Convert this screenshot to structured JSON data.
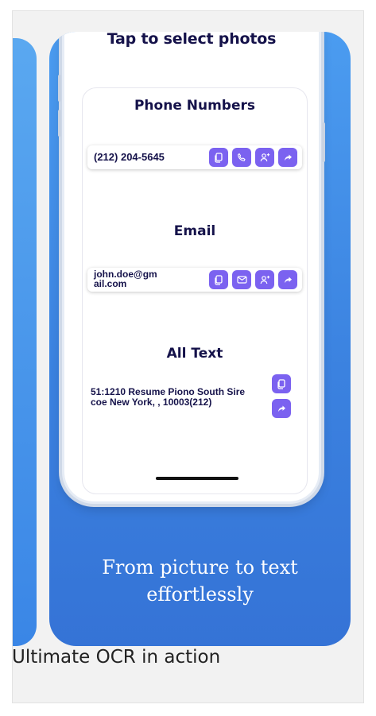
{
  "app_screen": {
    "tap_title": "Tap to select photos",
    "sections": {
      "phone": {
        "title": "Phone Numbers",
        "value": "(212) 204-5645",
        "actions": [
          "copy-icon",
          "phone-icon",
          "add-contact-icon",
          "share-icon"
        ]
      },
      "email": {
        "title": "Email",
        "value": "john.doe@gmail.com",
        "value_line1": "john.doe@gm",
        "value_line2": "ail.com",
        "actions": [
          "copy-icon",
          "mail-icon",
          "add-contact-icon",
          "share-icon"
        ]
      },
      "all_text": {
        "title": "All Text",
        "value": "51:1210 Resume Piono South Sire coe New York, , 10003(212)",
        "actions": [
          "copy-icon",
          "share-icon"
        ]
      }
    }
  },
  "promo_text": "From picture to text effortlessly",
  "caption": "Ultimate OCR in action",
  "colors": {
    "gradient_top": "#4b9cf0",
    "gradient_bottom": "#3573d6",
    "button": "#7b62f0",
    "heading": "#15124a"
  }
}
